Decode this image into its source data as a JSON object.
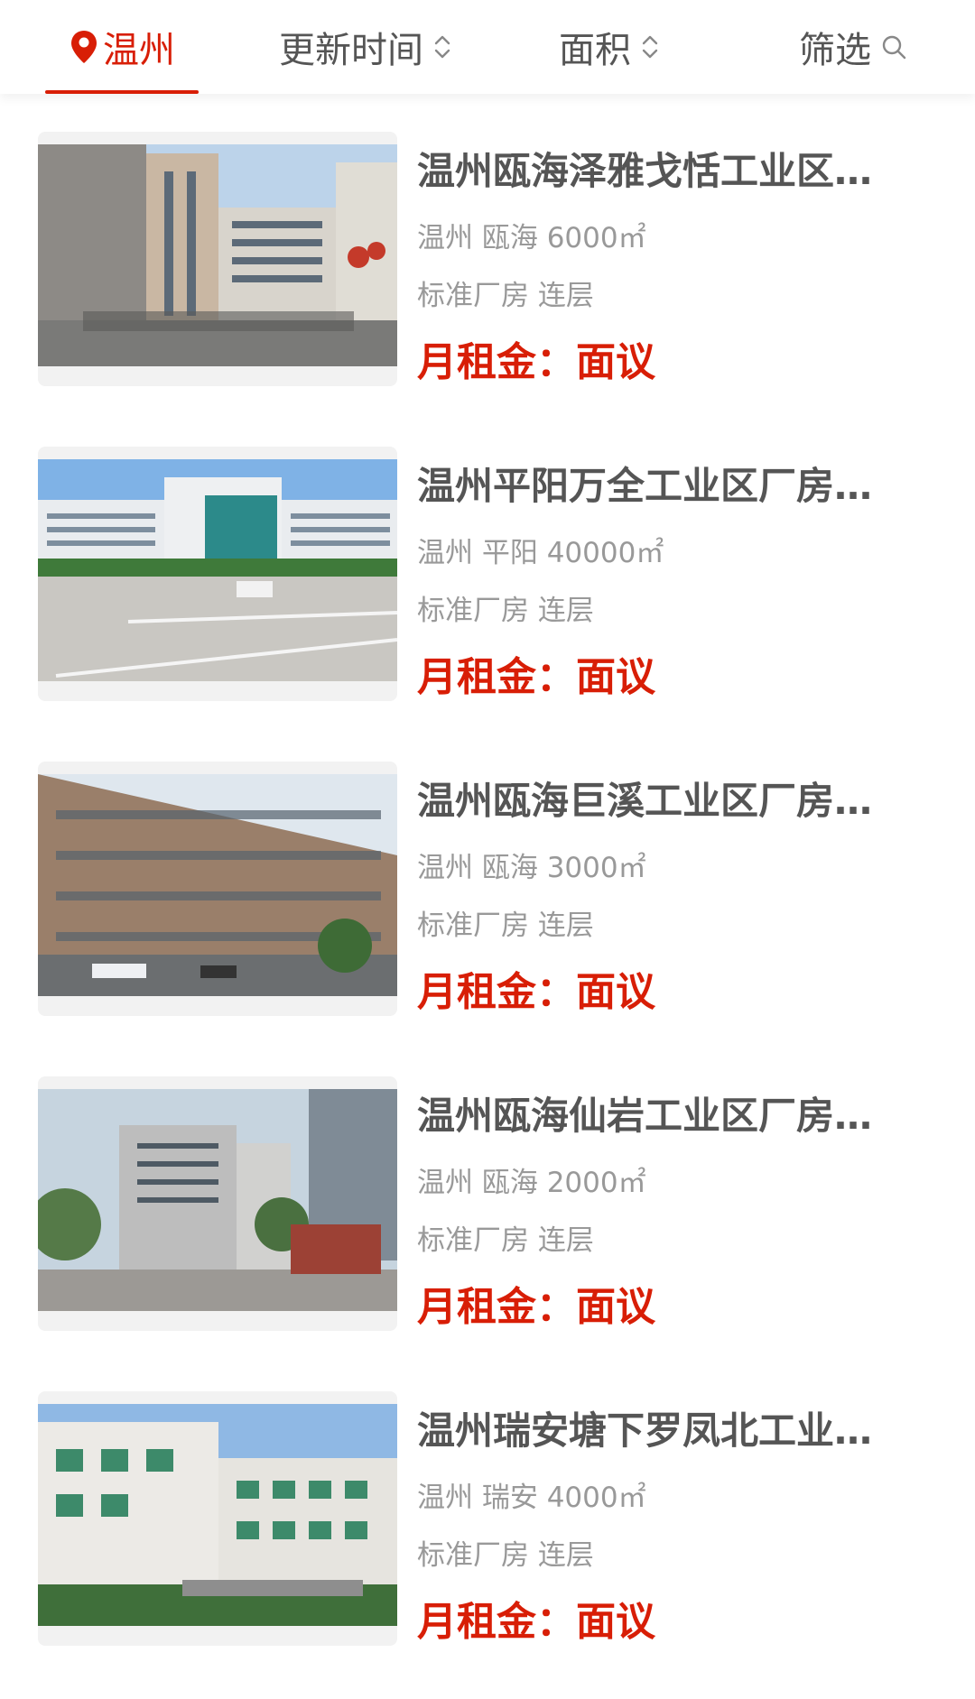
{
  "topbar": {
    "city": "温州",
    "update_time": "更新时间",
    "area": "面积",
    "filter": "筛选"
  },
  "colors": {
    "accent": "#d81e06",
    "text_dark": "#555555",
    "text_muted": "#999999"
  },
  "listings": [
    {
      "title": "温州瓯海泽雅戈恬工业区…",
      "meta": "温州 瓯海 6000㎡",
      "tags": "标准厂房 连层",
      "rent": "月租金：面议"
    },
    {
      "title": "温州平阳万全工业区厂房…",
      "meta": "温州 平阳 40000㎡",
      "tags": "标准厂房 连层",
      "rent": "月租金：面议"
    },
    {
      "title": "温州瓯海巨溪工业区厂房…",
      "meta": "温州 瓯海 3000㎡",
      "tags": "标准厂房 连层",
      "rent": "月租金：面议"
    },
    {
      "title": "温州瓯海仙岩工业区厂房…",
      "meta": "温州 瓯海 2000㎡",
      "tags": "标准厂房 连层",
      "rent": "月租金：面议"
    },
    {
      "title": "温州瑞安塘下罗凤北工业…",
      "meta": "温州 瑞安 4000㎡",
      "tags": "标准厂房 连层",
      "rent": "月租金：面议"
    }
  ]
}
